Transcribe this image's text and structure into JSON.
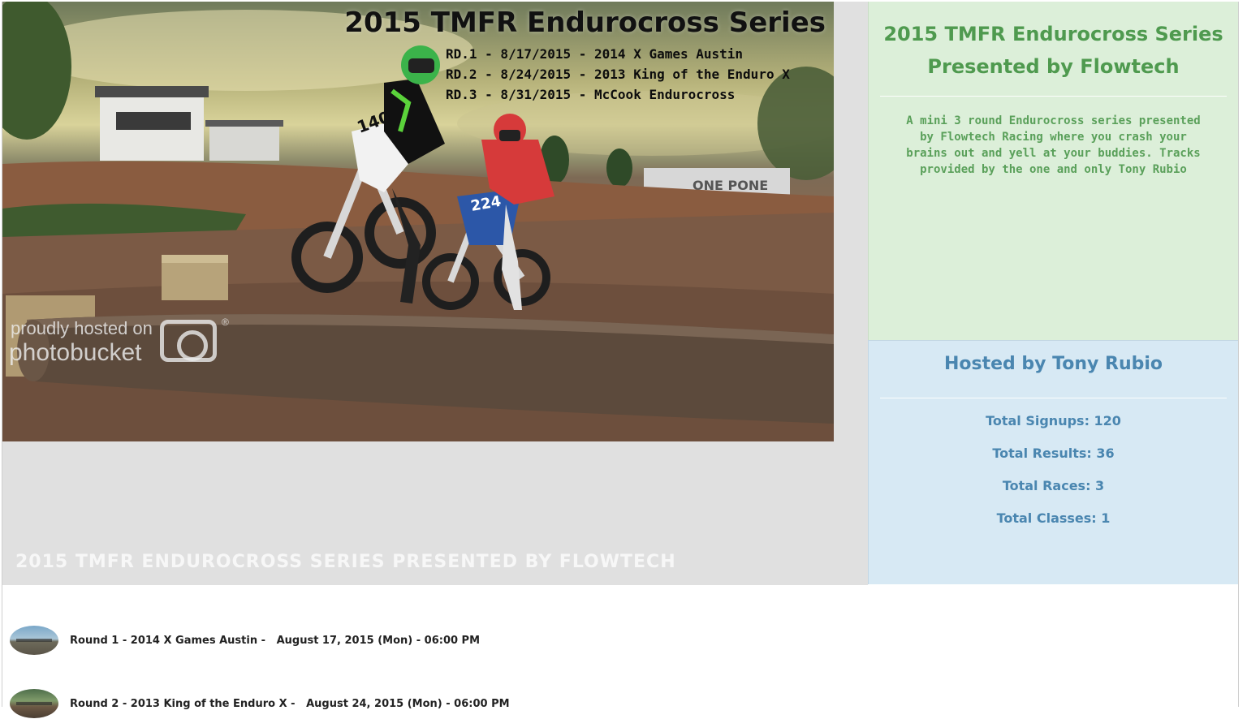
{
  "hero": {
    "banner_title": "2015 TMFR Endurocross Series",
    "rounds": [
      "RD.1 - 8/17/2015 - 2014 X Games Austin",
      "RD.2 - 8/24/2015 - 2013 King of the Enduro X",
      "RD.3 - 8/31/2015 - McCook Endurocross"
    ],
    "watermark_line1": "proudly hosted on",
    "watermark_line2": "photobucket",
    "watermark_reg": "®",
    "rider_numbers": [
      "140",
      "224"
    ],
    "sign_text": "ONE PONE",
    "caption": "2015 TMFR ENDUROCROSS SERIES PRESENTED BY FLOWTECH"
  },
  "info": {
    "title": "2015 TMFR Endurocross Series Presented by Flowtech",
    "description": "A mini 3 round Endurocross series presented by Flowtech Racing where you crash your brains out and yell at your buddies. Tracks provided by the one and only Tony Rubio",
    "bg_color": "#dcefd9",
    "text_color": "#4f9a4f"
  },
  "stats": {
    "title": "Hosted by Tony Rubio",
    "signups": "Total Signups: 120",
    "results": "Total Results: 36",
    "races": "Total Races: 3",
    "classes": "Total Classes: 1",
    "bg_color": "#d7e9f4",
    "text_color": "#4a86b0"
  },
  "races": [
    {
      "text": "Round 1 - 2014 X Games Austin -   August 17, 2015 (Mon) - 06:00 PM"
    },
    {
      "text": "Round 2 - 2013 King of the Enduro X -   August 24, 2015 (Mon) - 06:00 PM"
    }
  ]
}
